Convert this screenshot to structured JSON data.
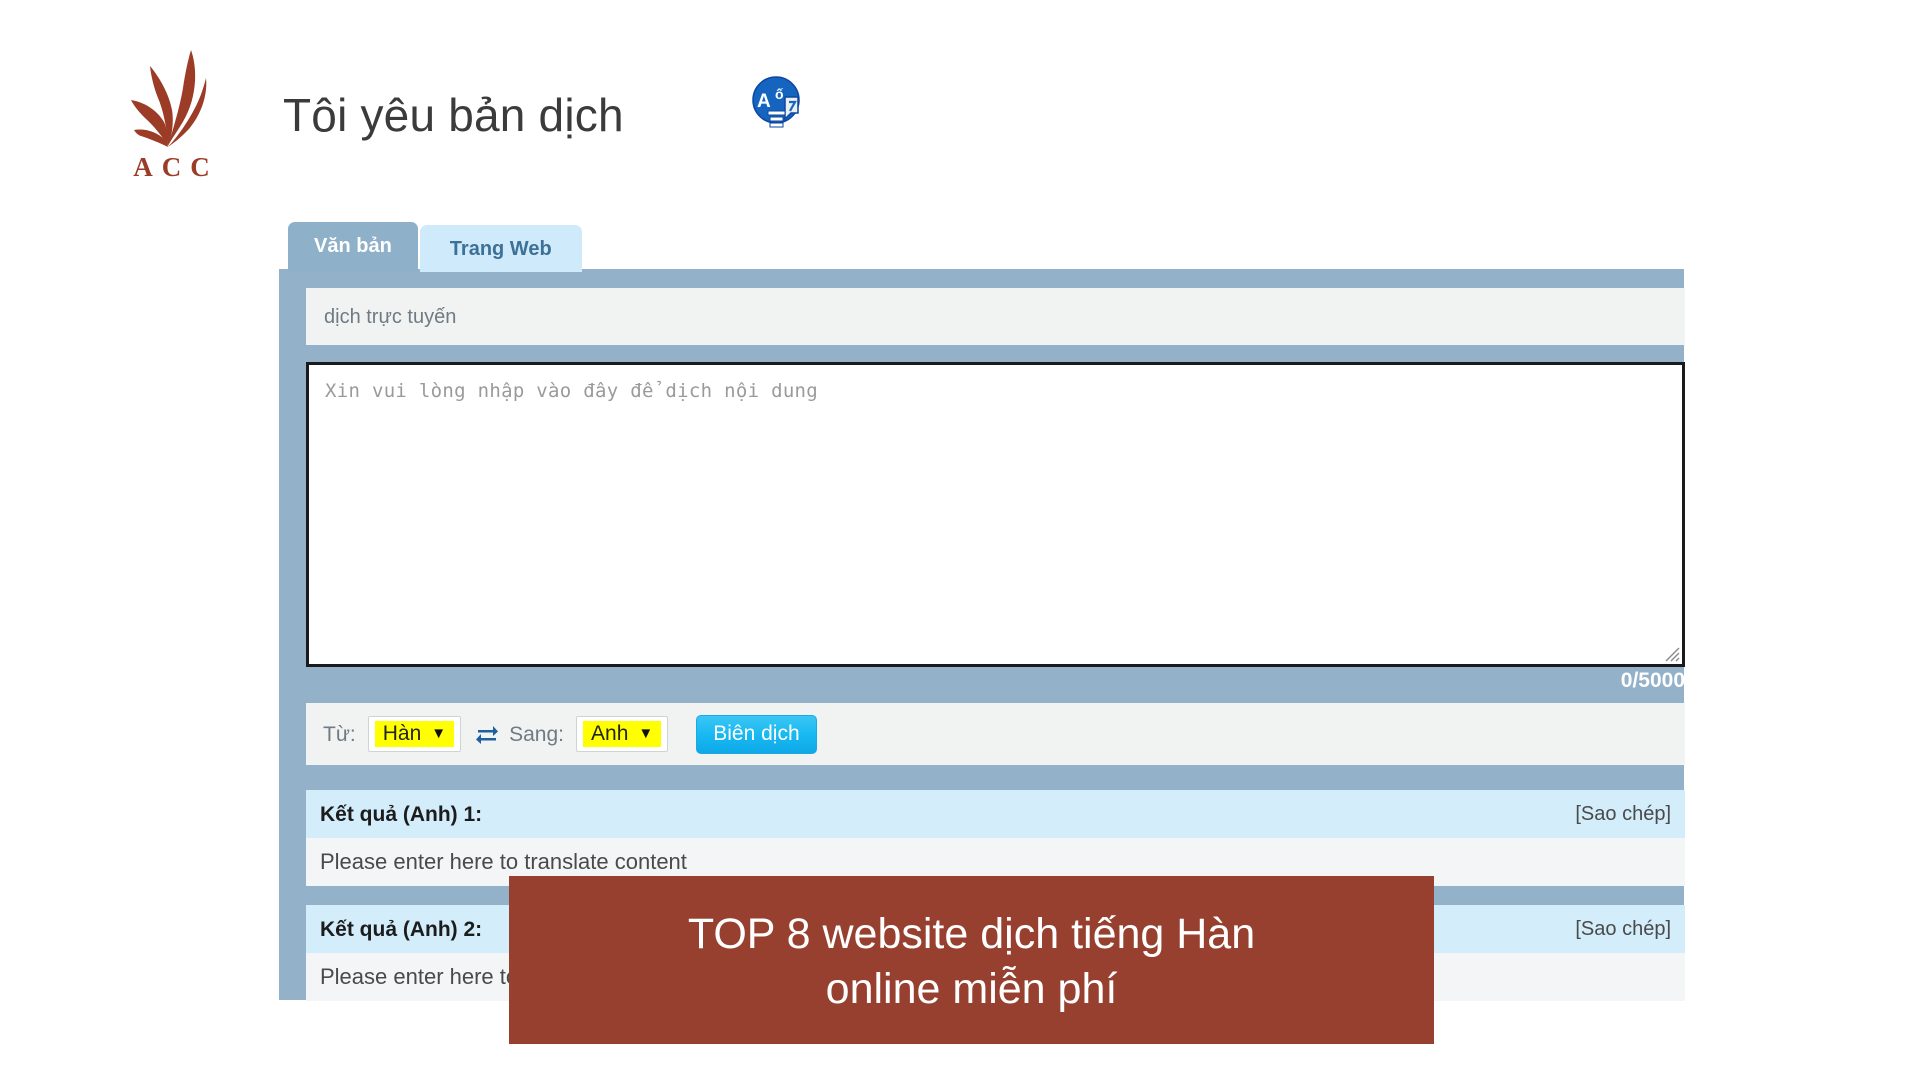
{
  "brand": {
    "logo_icon": "acc-flame-logo",
    "letters": "ACC",
    "color": "#9c3c27"
  },
  "header": {
    "title": "Tôi yêu bản dịch",
    "title_icon": "translate-badge-icon"
  },
  "tabs": [
    {
      "label": "Văn bản",
      "active": true
    },
    {
      "label": "Trang Web",
      "active": false
    }
  ],
  "subheader": {
    "text": "dịch trực tuyến"
  },
  "editor": {
    "placeholder": "Xin vui lòng nhập vào đây để dịch nội dung",
    "value": "",
    "counter": "0/5000",
    "resize_icon": "resize-grip-icon"
  },
  "language_bar": {
    "from_label": "Từ:",
    "from_value": "Hàn",
    "swap_icon": "swap-arrows-icon",
    "to_label": "Sang:",
    "to_value": "Anh",
    "caret_icon": "chevron-down-icon",
    "translate_button": "Biên dịch",
    "highlight_color": "#ffff00",
    "button_color": "#18b9f2"
  },
  "results": [
    {
      "title": "Kết quả (Anh) 1:",
      "copy_label": "[Sao chép]",
      "text": "Please enter here to translate content"
    },
    {
      "title": "Kết quả (Anh) 2:",
      "copy_label": "[Sao chép]",
      "text": "Please enter here to translate content"
    }
  ],
  "overlay_banner": {
    "line1": "TOP 8 website dịch tiếng Hàn",
    "line2": "online miễn phí",
    "background": "#97402f"
  }
}
